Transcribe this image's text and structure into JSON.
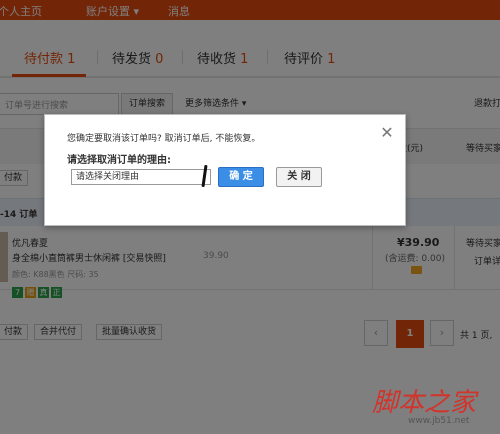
{
  "topnav": {
    "items": [
      "个人主页",
      "账户设置 ▾",
      "消息"
    ]
  },
  "tabs": [
    {
      "label": "待付款",
      "count": "1"
    },
    {
      "label": "待发货",
      "count": "0"
    },
    {
      "label": "待收货",
      "count": "1"
    },
    {
      "label": "待评价",
      "count": "1"
    }
  ],
  "search": {
    "placeholder": "订单号进行搜索",
    "button": "订单搜索",
    "more_filter": "更多筛选条件 ▾",
    "refund": "退款打"
  },
  "table_header": {
    "paid_col": "付款(元)",
    "buyer_col": "等待买家"
  },
  "batch": {
    "pay": "付款",
    "merge_pay": "合并代付",
    "batch_confirm": "批量确认收货"
  },
  "order": {
    "date": "-14 订单",
    "product_name": "优凡春夏",
    "product_desc": "身全棉小直筒裤男士休闲裤 [交易快照]",
    "list_price": "39.90",
    "attrs": "颜色: K88黑色 尺码: 35",
    "badges": [
      "7",
      "赠",
      "真",
      "正"
    ],
    "paid_amount": "¥39.90",
    "shipping": "(含运费: 0.00)",
    "buyer_status_1": "等待买家",
    "buyer_status_2": "订单详"
  },
  "pager": {
    "prev": "‹",
    "current": "1",
    "next": "›",
    "total": "共 1 页,"
  },
  "dialog": {
    "message": "您确定要取消该订单吗? 取消订单后, 不能恢复。",
    "label": "请选择取消订单的理由:",
    "select_value": "请选择关闭理由",
    "ok": "确 定",
    "cancel": "关 闭",
    "close_glyph": "✕"
  },
  "watermark": {
    "text": "脚本之家",
    "url": "www.jb51.net"
  },
  "colors": {
    "brand": "#e74c0f",
    "primary_button": "#3a8ee6"
  }
}
